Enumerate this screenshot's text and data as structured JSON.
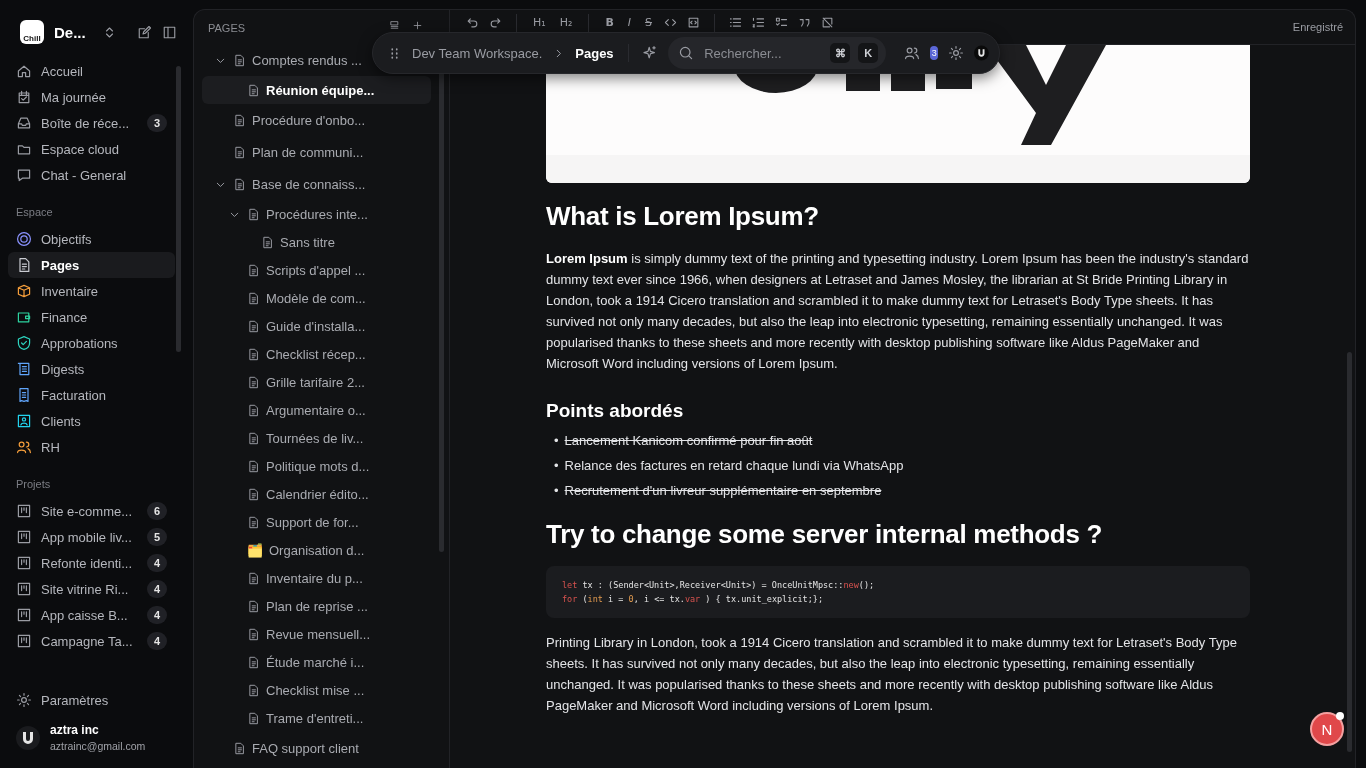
{
  "workspace": {
    "logo_text": "Chill",
    "name": "De..."
  },
  "nav": [
    {
      "label": "Accueil",
      "selected": false
    },
    {
      "label": "Ma journée",
      "selected": false
    },
    {
      "label": "Boîte de réce...",
      "selected": false,
      "badge": "3"
    },
    {
      "label": "Espace cloud",
      "selected": false
    },
    {
      "label": "Chat - General",
      "selected": false
    }
  ],
  "space": {
    "title": "Espace",
    "items": [
      {
        "label": "Objectifs",
        "selected": false
      },
      {
        "label": "Pages",
        "selected": true
      },
      {
        "label": "Inventaire",
        "selected": false
      },
      {
        "label": "Finance",
        "selected": false
      },
      {
        "label": "Approbations",
        "selected": false
      },
      {
        "label": "Digests",
        "selected": false
      },
      {
        "label": "Facturation",
        "selected": false
      },
      {
        "label": "Clients",
        "selected": false
      },
      {
        "label": "RH",
        "selected": false
      }
    ]
  },
  "projects": {
    "title": "Projets",
    "items": [
      {
        "label": "Site e-comme...",
        "badge": "6",
        "selected": false
      },
      {
        "label": "App mobile liv...",
        "badge": "5",
        "selected": false
      },
      {
        "label": "Refonte identi...",
        "badge": "4",
        "selected": false
      },
      {
        "label": "Site vitrine Ri...",
        "badge": "4",
        "selected": false
      },
      {
        "label": "App caisse B...",
        "badge": "4",
        "selected": false
      },
      {
        "label": "Campagne Ta...",
        "badge": "4",
        "selected": false
      }
    ]
  },
  "settings": {
    "label": "Paramètres"
  },
  "user": {
    "name": "aztra inc",
    "email": "aztrainc@gmail.com"
  },
  "pages_panel": {
    "title": "PAGES",
    "tree": [
      {
        "label": "Comptes rendus ...",
        "selected": false,
        "expanded": true,
        "children": [
          {
            "label": "Réunion équipe...",
            "selected": true
          }
        ]
      },
      {
        "label": "Procédure d'onbo...",
        "selected": false
      },
      {
        "label": "Plan de communi...",
        "selected": false
      },
      {
        "label": "Base de connaiss...",
        "selected": false,
        "expanded": true,
        "children": [
          {
            "label": "Procédures inte...",
            "selected": false,
            "expanded": true,
            "children": [
              {
                "label": "Sans titre",
                "selected": false
              }
            ]
          },
          {
            "label": "Scripts d'appel ...",
            "selected": false
          },
          {
            "label": "Modèle de com...",
            "selected": false
          },
          {
            "label": "Guide d'installa...",
            "selected": false
          },
          {
            "label": "Checklist récep...",
            "selected": false
          },
          {
            "label": "Grille tarifaire 2...",
            "selected": false
          },
          {
            "label": "Argumentaire o...",
            "selected": false
          },
          {
            "label": "Tournées de liv...",
            "selected": false
          },
          {
            "label": "Politique mots d...",
            "selected": false
          },
          {
            "label": "Calendrier édito...",
            "selected": false
          },
          {
            "label": "Support de for...",
            "selected": false
          },
          {
            "label": "Organisation d...",
            "selected": false,
            "emoji": "🗂️"
          },
          {
            "label": "Inventaire du p...",
            "selected": false
          },
          {
            "label": "Plan de reprise ...",
            "selected": false
          },
          {
            "label": "Revue mensuell...",
            "selected": false
          },
          {
            "label": "Étude marché i...",
            "selected": false
          },
          {
            "label": "Checklist mise ...",
            "selected": false
          },
          {
            "label": "Trame d'entreti...",
            "selected": false
          }
        ]
      },
      {
        "label": "FAQ support client",
        "selected": false
      }
    ]
  },
  "toolbar": [
    [
      {
        "kind": "undo"
      },
      {
        "kind": "redo"
      }
    ],
    [
      {
        "kind": "heading",
        "label": "H₁"
      },
      {
        "kind": "heading",
        "label": "H₂"
      }
    ],
    [
      {
        "kind": "bold",
        "label": "B"
      },
      {
        "kind": "italic",
        "label": "I"
      },
      {
        "kind": "strike",
        "label": "S"
      },
      {
        "kind": "code"
      },
      {
        "kind": "codeblock"
      }
    ],
    [
      {
        "kind": "bullets"
      },
      {
        "kind": "numbers"
      },
      {
        "kind": "tasks"
      },
      {
        "kind": "quote"
      },
      {
        "kind": "clear"
      }
    ]
  ],
  "save_status": "Enregistré",
  "command_bar": {
    "breadcrumb": [
      "Dev Team Workspace.",
      "Pages"
    ],
    "search_placeholder": "Rechercher...",
    "keys": [
      "⌘",
      "K"
    ],
    "notifications": "3"
  },
  "article": {
    "blocks": [
      {
        "kind": "h2",
        "text": "What is Lorem Ipsum?"
      },
      {
        "kind": "p",
        "text": "**Lorem Ipsum** is simply dummy text of the printing and typesetting industry. Lorem Ipsum has been the industry's standard dummy text ever since 1966, when designers at Letraset and James Mosley, the librarian at St Bride Printing Library in London, took a 1914 Cicero translation and scrambled it to make dummy text for Letraset's Body Type sheets. It has survived not only many decades, but also the leap into electronic typesetting, remaining essentially unchanged. It was popularised thanks to these sheets and more recently with desktop publishing software like Aldus PageMaker and Microsoft Word including versions of Lorem Ipsum."
      },
      {
        "kind": "h3",
        "text": "Points abordés"
      },
      {
        "kind": "list",
        "marker": "•",
        "items": [
          {
            "text": "Lancement Kanicom confirmé pour fin août",
            "done": true
          },
          {
            "text": "Relance des factures en retard chaque lundi via WhatsApp",
            "done": false
          },
          {
            "text": "Recrutement d'un livreur supplémentaire en septembre",
            "done": true
          }
        ]
      },
      {
        "kind": "h2",
        "text": "Try to change some server internal methods ?"
      },
      {
        "kind": "code",
        "lines": [
          [
            {
              "kind": "keyword",
              "text": "let"
            },
            {
              "kind": "plain",
              "text": " tx : (Sender<Unit>,Receiver<Unit>) = OnceUnitMpsc::"
            },
            {
              "kind": "keyword",
              "text": "new"
            },
            {
              "kind": "plain",
              "text": "();"
            }
          ],
          [
            {
              "kind": "keyword",
              "text": "for"
            },
            {
              "kind": "plain",
              "text": " ("
            },
            {
              "kind": "type",
              "text": "int"
            },
            {
              "kind": "plain",
              "text": " i = "
            },
            {
              "kind": "type",
              "text": "0"
            },
            {
              "kind": "plain",
              "text": ", i <= tx."
            },
            {
              "kind": "keyword",
              "text": "var"
            },
            {
              "kind": "plain",
              "text": " ) { tx.unit_explicit;};"
            }
          ]
        ]
      },
      {
        "kind": "p",
        "text": "Printing Library in London, took a 1914 Cicero translation and scrambled it to make dummy text for Letraset's Body Type sheets. It has survived not only many decades, but also the leap into electronic typesetting, remaining essentially unchanged. It was popularised thanks to these sheets and more recently with desktop publishing software like Aldus PageMaker and Microsoft Word including versions of Lorem Ipsum."
      }
    ]
  },
  "floating_button": {
    "label": "N"
  }
}
